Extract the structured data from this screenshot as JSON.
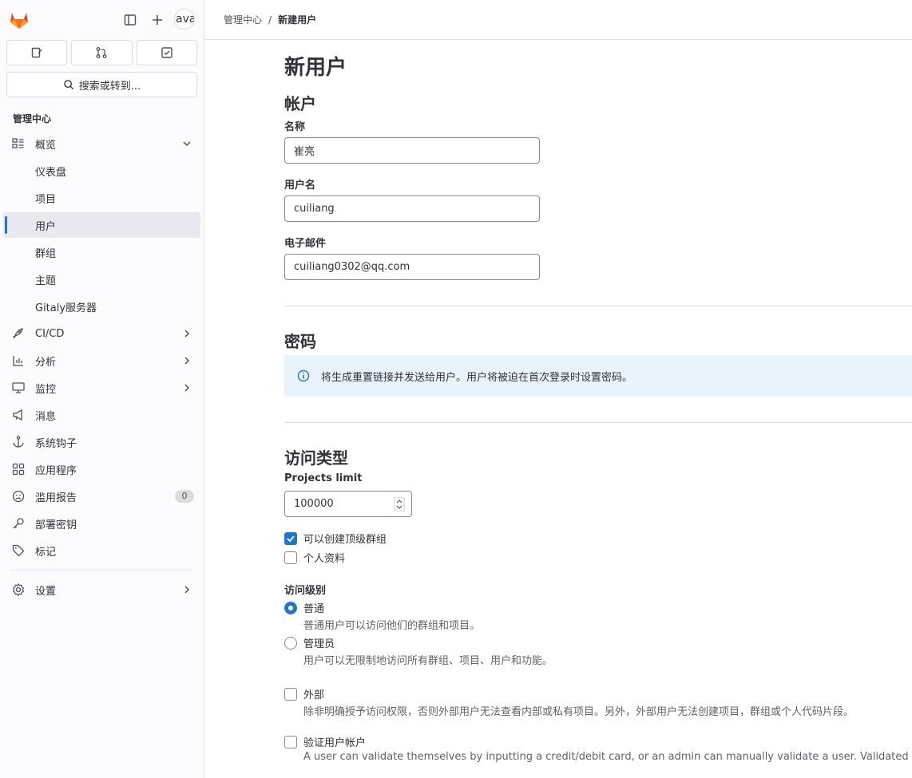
{
  "sidebar": {
    "avatar_text": "ava",
    "search_label": "搜索或转到...",
    "section_title": "管理中心",
    "items": [
      {
        "label": "概览",
        "icon": "overview-icon",
        "chevron": "down"
      },
      {
        "label": "仪表盘"
      },
      {
        "label": "项目"
      },
      {
        "label": "用户",
        "active": true
      },
      {
        "label": "群组"
      },
      {
        "label": "主题"
      },
      {
        "label": "Gitaly服务器"
      },
      {
        "label": "CI/CD",
        "icon": "rocket-icon",
        "chevron": "right"
      },
      {
        "label": "分析",
        "icon": "chart-icon",
        "chevron": "right"
      },
      {
        "label": "监控",
        "icon": "monitor-icon",
        "chevron": "right"
      },
      {
        "label": "消息",
        "icon": "megaphone-icon"
      },
      {
        "label": "系统钩子",
        "icon": "anchor-icon"
      },
      {
        "label": "应用程序",
        "icon": "apps-icon"
      },
      {
        "label": "滥用报告",
        "icon": "abuse-icon",
        "badge": "0"
      },
      {
        "label": "部署密钥",
        "icon": "key-icon"
      },
      {
        "label": "标记",
        "icon": "label-icon"
      },
      {
        "label": "设置",
        "icon": "settings-icon",
        "chevron": "right"
      }
    ]
  },
  "breadcrumb": {
    "parent": "管理中心",
    "separator": "/",
    "current": "新建用户"
  },
  "form": {
    "page_title": "新用户",
    "account_title": "帐户",
    "name_label": "名称",
    "name_value": "崔亮",
    "username_label": "用户名",
    "username_value": "cuiliang",
    "email_label": "电子邮件",
    "email_value": "cuiliang0302@qq.com",
    "password_title": "密码",
    "password_alert": "将生成重置链接并发送给用户。用户将被迫在首次登录时设置密码。",
    "access_title": "访问类型",
    "projects_limit_label": "Projects limit",
    "projects_limit_value": "100000",
    "can_create_group_label": "可以创建顶级群组",
    "can_create_group_checked": true,
    "private_profile_label": "个人资料",
    "private_profile_checked": false,
    "access_level_label": "访问级别",
    "regular_label": "普通",
    "regular_help": "普通用户可以访问他们的群组和项目。",
    "admin_label": "管理员",
    "admin_help": "用户可以无限制地访问所有群组、项目、用户和功能。",
    "external_label": "外部",
    "external_help": "除非明确授予访问权限，否则外部用户无法查看内部或私有项目。另外，外部用户无法创建项目，群组或个人代码片段。",
    "validate_label": "验证用户帐户",
    "validate_help": "A user can validate themselves by inputting a credit/debit card, or an admin can manually validate a user. Validated"
  },
  "colors": {
    "accent": "#1f75cb",
    "sidebar_bg": "#fbfafd",
    "alert_bg": "#e9f3fc"
  }
}
